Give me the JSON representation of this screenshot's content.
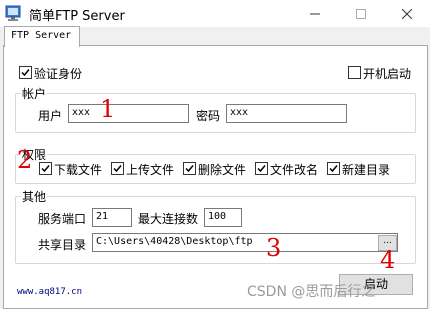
{
  "window": {
    "title": "简单FTP Server"
  },
  "tabs": [
    {
      "label": "FTP Server"
    }
  ],
  "auth": {
    "verify_label": "验证身份",
    "verify_checked": true,
    "autostart_label": "开机启动",
    "autostart_checked": false
  },
  "account": {
    "group_title": "帐户",
    "user_label": "用户",
    "user_value": "xxx",
    "password_label": "密码",
    "password_value": "xxx"
  },
  "permissions": {
    "group_title": "权限",
    "items": [
      {
        "label": "下载文件",
        "checked": true
      },
      {
        "label": "上传文件",
        "checked": true
      },
      {
        "label": "删除文件",
        "checked": true
      },
      {
        "label": "文件改名",
        "checked": true
      },
      {
        "label": "新建目录",
        "checked": true
      }
    ]
  },
  "other": {
    "group_title": "其他",
    "port_label": "服务端口",
    "port_value": "21",
    "maxconn_label": "最大连接数",
    "maxconn_value": "100",
    "share_label": "共享目录",
    "share_value": "C:\\Users\\40428\\Desktop\\ftp",
    "browse_label": "..."
  },
  "start_button": {
    "label": "启动"
  },
  "footer": {
    "link": "www.aq817.cn"
  },
  "annotations": [
    "1",
    "2",
    "3",
    "4"
  ],
  "watermark": "CSDN @思而后行之",
  "colors": {
    "annotation": "#e00000",
    "link": "#00007f"
  }
}
